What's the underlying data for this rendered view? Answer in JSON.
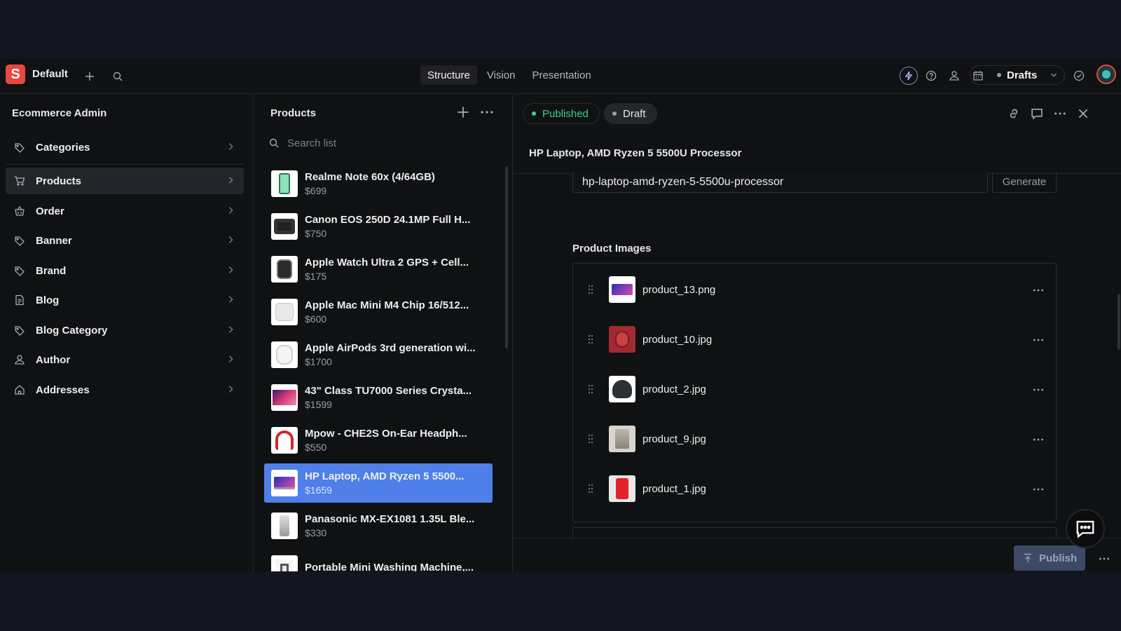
{
  "topbar": {
    "logo_letter": "S",
    "workspace": "Default",
    "tabs": [
      {
        "label": "Structure",
        "active": true
      },
      {
        "label": "Vision",
        "active": false
      },
      {
        "label": "Presentation",
        "active": false
      }
    ],
    "release": "Drafts"
  },
  "nav": {
    "title": "Ecommerce Admin",
    "items": [
      {
        "label": "Categories",
        "icon": "tag-icon"
      },
      {
        "label": "Products",
        "icon": "cart-icon",
        "active": true
      },
      {
        "label": "Order",
        "icon": "basket-icon"
      },
      {
        "label": "Banner",
        "icon": "tag-icon"
      },
      {
        "label": "Brand",
        "icon": "tag-icon"
      },
      {
        "label": "Blog",
        "icon": "document-icon"
      },
      {
        "label": "Blog Category",
        "icon": "tag-icon"
      },
      {
        "label": "Author",
        "icon": "user-icon"
      },
      {
        "label": "Addresses",
        "icon": "home-icon"
      }
    ]
  },
  "products": {
    "title": "Products",
    "search_placeholder": "Search list",
    "items": [
      {
        "name": "Realme Note 60x (4/64GB)",
        "price": "$699"
      },
      {
        "name": "Canon EOS 250D 24.1MP Full H...",
        "price": "$750"
      },
      {
        "name": "Apple Watch Ultra 2 GPS + Cell...",
        "price": "$175"
      },
      {
        "name": "Apple Mac Mini M4 Chip 16/512...",
        "price": "$600"
      },
      {
        "name": "Apple AirPods 3rd generation wi...",
        "price": "$1700"
      },
      {
        "name": "43\" Class TU7000 Series Crysta...",
        "price": "$1599"
      },
      {
        "name": "Mpow - CHE2S On-Ear Headph...",
        "price": "$550"
      },
      {
        "name": "HP Laptop, AMD Ryzen 5 5500...",
        "price": "$1659",
        "selected": true
      },
      {
        "name": "Panasonic MX-EX1081 1.35L Ble...",
        "price": "$330"
      },
      {
        "name": "Portable Mini Washing Machine,...",
        "price": ""
      }
    ]
  },
  "editor": {
    "status_published": "Published",
    "status_draft": "Draft",
    "document_title": "HP Laptop, AMD Ryzen 5 5500U Processor",
    "slug_value": "hp-laptop-amd-ryzen-5-5500u-processor",
    "generate_label": "Generate",
    "images_label": "Product Images",
    "images": [
      {
        "file": "product_13.png"
      },
      {
        "file": "product_10.jpg"
      },
      {
        "file": "product_2.jpg"
      },
      {
        "file": "product_9.jpg"
      },
      {
        "file": "product_1.jpg"
      }
    ],
    "publish_label": "Publish"
  },
  "colors": {
    "accent_selected": "#4f7fe8",
    "published_green": "#3fcf8e",
    "logo_red": "#e5483f"
  }
}
